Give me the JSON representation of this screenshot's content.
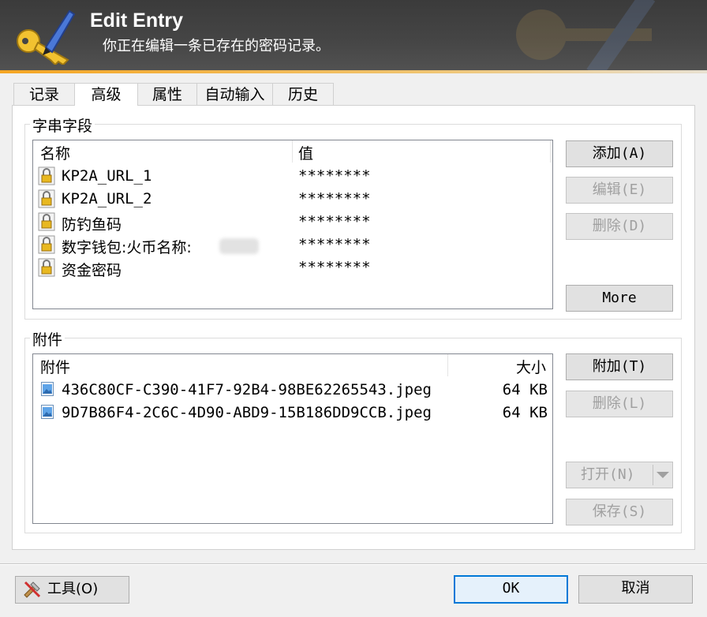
{
  "window": {
    "title": "Edit Entry",
    "subtitle": "你正在编辑一条已存在的密码记录。"
  },
  "tabs": [
    {
      "label": "记录",
      "active": false
    },
    {
      "label": "高级",
      "active": true
    },
    {
      "label": "属性",
      "active": false
    },
    {
      "label": "自动输入",
      "active": false
    },
    {
      "label": "历史",
      "active": false
    }
  ],
  "strings": {
    "group_title": "字串字段",
    "columns": {
      "name": "名称",
      "value": "值"
    },
    "rows": [
      {
        "name": "KP2A_URL_1",
        "value": "********"
      },
      {
        "name": "KP2A_URL_2",
        "value": "********"
      },
      {
        "name": "防钓鱼码",
        "value": "********"
      },
      {
        "name": "数字钱包:火币名称:",
        "value": "********"
      },
      {
        "name": "资金密码",
        "value": "********"
      }
    ],
    "buttons": {
      "add": "添加(A)",
      "edit": "编辑(E)",
      "delete": "删除(D)",
      "more": "More"
    }
  },
  "attachments": {
    "group_title": "附件",
    "columns": {
      "name": "附件",
      "size": "大小"
    },
    "rows": [
      {
        "name": "436C80CF-C390-41F7-92B4-98BE62265543.jpeg",
        "size": "64 KB"
      },
      {
        "name": "9D7B86F4-2C6C-4D90-ABD9-15B186DD9CCB.jpeg",
        "size": "64 KB"
      }
    ],
    "buttons": {
      "attach": "附加(T)",
      "delete": "删除(L)",
      "open": "打开(N)",
      "save": "保存(S)"
    }
  },
  "footer": {
    "tools": "工具(O)",
    "ok": "OK",
    "cancel": "取消"
  },
  "colors": {
    "accent": "#0078d7",
    "banner": "#454545",
    "banner_stripe": "#f5a623"
  }
}
